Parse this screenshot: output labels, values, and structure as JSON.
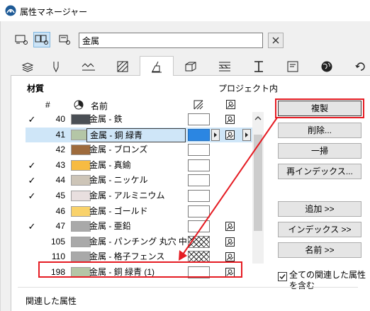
{
  "window": {
    "title": "属性マネージャー"
  },
  "search": {
    "value": "金属"
  },
  "view_buttons": [
    "list-view-icon",
    "grid-view-icon",
    "detail-view-icon"
  ],
  "tabs": [
    {
      "icon": "layers-icon"
    },
    {
      "icon": "pen-icon"
    },
    {
      "icon": "line-type-icon"
    },
    {
      "icon": "fill-icon"
    },
    {
      "icon": "surface-icon",
      "active": true
    },
    {
      "icon": "building-material-icon"
    },
    {
      "icon": "composite-icon"
    },
    {
      "icon": "profile-icon"
    },
    {
      "icon": "zone-icon"
    },
    {
      "icon": "globe-icon"
    },
    {
      "icon": "renovation-icon"
    }
  ],
  "panel": {
    "heading": "材質",
    "project_label": "プロジェクト内",
    "columns": {
      "num": "#",
      "name": "名前"
    }
  },
  "rows": [
    {
      "check": "✓",
      "num": "40",
      "color": "#4a4f55",
      "name": "金属 - 鉄",
      "fill": "empty",
      "texture": true
    },
    {
      "check": "",
      "num": "41",
      "color": "#b4c6a6",
      "name": "金属 - 銅 緑青",
      "fill": "blue",
      "texture": true,
      "selected": true
    },
    {
      "check": "",
      "num": "42",
      "color": "#9e6b3c",
      "name": "金属 - ブロンズ",
      "fill": "empty",
      "texture": false
    },
    {
      "check": "✓",
      "num": "43",
      "color": "#f7bb42",
      "name": "金属 - 真鍮",
      "fill": "empty",
      "texture": false
    },
    {
      "check": "✓",
      "num": "44",
      "color": "#cdc5b8",
      "name": "金属 - ニッケル",
      "fill": "empty",
      "texture": false
    },
    {
      "check": "✓",
      "num": "45",
      "color": "#e8dfdf",
      "name": "金属 - アルミニウム",
      "fill": "empty",
      "texture": false
    },
    {
      "check": "",
      "num": "46",
      "color": "#f9d26b",
      "name": "金属 - ゴールド",
      "fill": "empty",
      "texture": false
    },
    {
      "check": "✓",
      "num": "47",
      "color": "#a9a9a9",
      "name": "金属 - 亜鉛",
      "fill": "empty",
      "texture": true
    },
    {
      "check": "",
      "num": "105",
      "color": "#a9a9a9",
      "name": "金属 - パンチング 丸穴 中",
      "fill": "hatch",
      "texture": true
    },
    {
      "check": "",
      "num": "110",
      "color": "#a9a9a9",
      "name": "金属 - 格子フェンス",
      "fill": "hatch",
      "texture": true
    },
    {
      "check": "",
      "num": "198",
      "color": "#b4c6a6",
      "name": "金属 - 銅 緑青 (1)",
      "fill": "empty",
      "texture": true
    }
  ],
  "buttons": {
    "duplicate": "複製",
    "delete": "削除...",
    "purge": "一掃",
    "reindex": "再インデックス...",
    "add": "追加 >>",
    "index": "インデックス >>",
    "name": "名前 >>"
  },
  "checkbox": {
    "label": "全ての関連した属性を含む",
    "checked": true
  },
  "related_label": "関連した属性",
  "colors": {
    "highlight": "#e51c23",
    "selected_row": "#cfe6f8",
    "accent": "#2b86e2"
  }
}
